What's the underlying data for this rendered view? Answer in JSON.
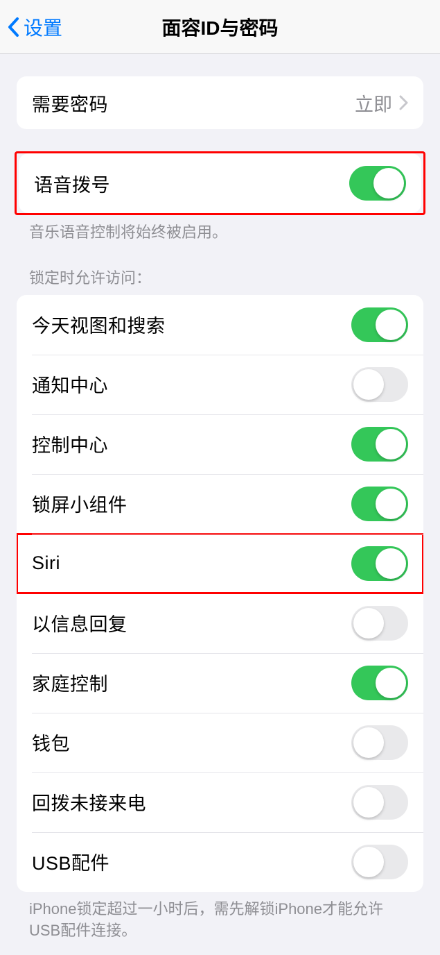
{
  "nav": {
    "back_label": "设置",
    "title": "面容ID与密码"
  },
  "require_passcode": {
    "label": "需要密码",
    "value": "立即"
  },
  "voice_dial": {
    "label": "语音拨号",
    "on": true,
    "footer": "音乐语音控制将始终被启用。"
  },
  "lock_access": {
    "header": "锁定时允许访问：",
    "items": [
      {
        "label": "今天视图和搜索",
        "on": true
      },
      {
        "label": "通知中心",
        "on": false
      },
      {
        "label": "控制中心",
        "on": true
      },
      {
        "label": "锁屏小组件",
        "on": true
      },
      {
        "label": "Siri",
        "on": true,
        "highlighted": true
      },
      {
        "label": "以信息回复",
        "on": false
      },
      {
        "label": "家庭控制",
        "on": true
      },
      {
        "label": "钱包",
        "on": false
      },
      {
        "label": "回拨未接来电",
        "on": false
      },
      {
        "label": "USB配件",
        "on": false
      }
    ],
    "footer": "iPhone锁定超过一小时后，需先解锁iPhone才能允许USB配件连接。"
  }
}
